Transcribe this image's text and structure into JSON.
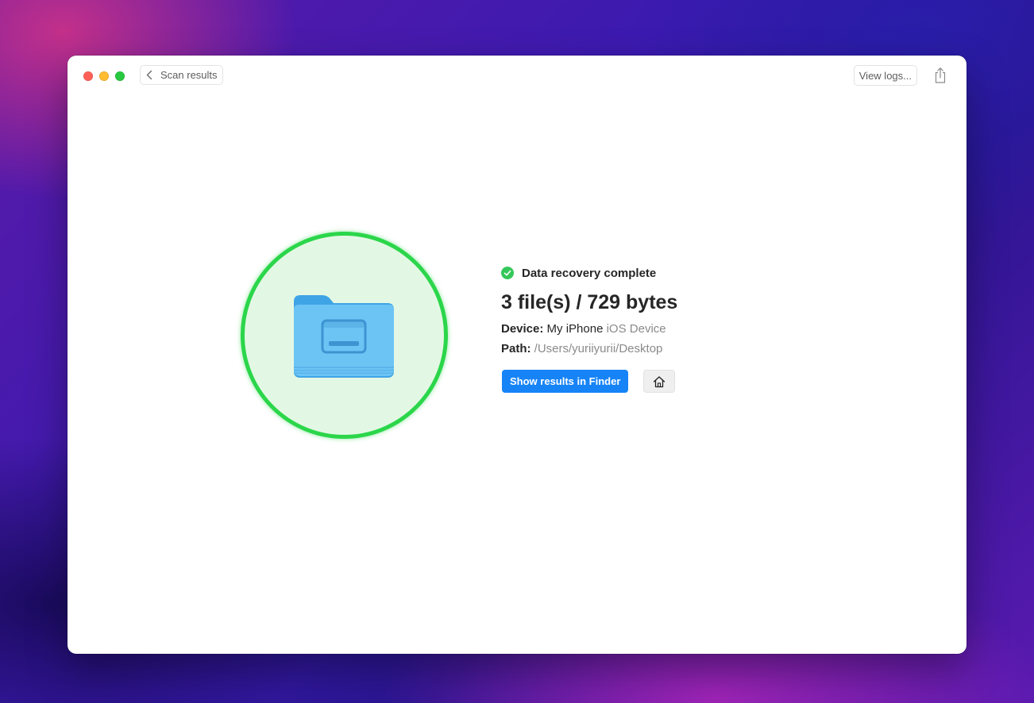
{
  "toolbar": {
    "back_label": "Scan results",
    "logs_label": "View logs..."
  },
  "result": {
    "status": "Data recovery complete",
    "summary": "3 file(s) / 729 bytes",
    "device_label": "Device:",
    "device_name": "My iPhone",
    "device_type": "iOS Device",
    "path_label": "Path:",
    "path_value": "/Users/yuriiyurii/Desktop",
    "show_button": "Show results in Finder"
  },
  "colors": {
    "accent": "#1684f7",
    "success": "#2bd64a",
    "success_fill": "#e3f8e4",
    "folder": "#6cc4f5"
  },
  "icons": {
    "back": "chevron-left-icon",
    "share": "share-icon",
    "status": "checkmark-circle-icon",
    "folder": "folder-icon",
    "home": "home-icon"
  }
}
